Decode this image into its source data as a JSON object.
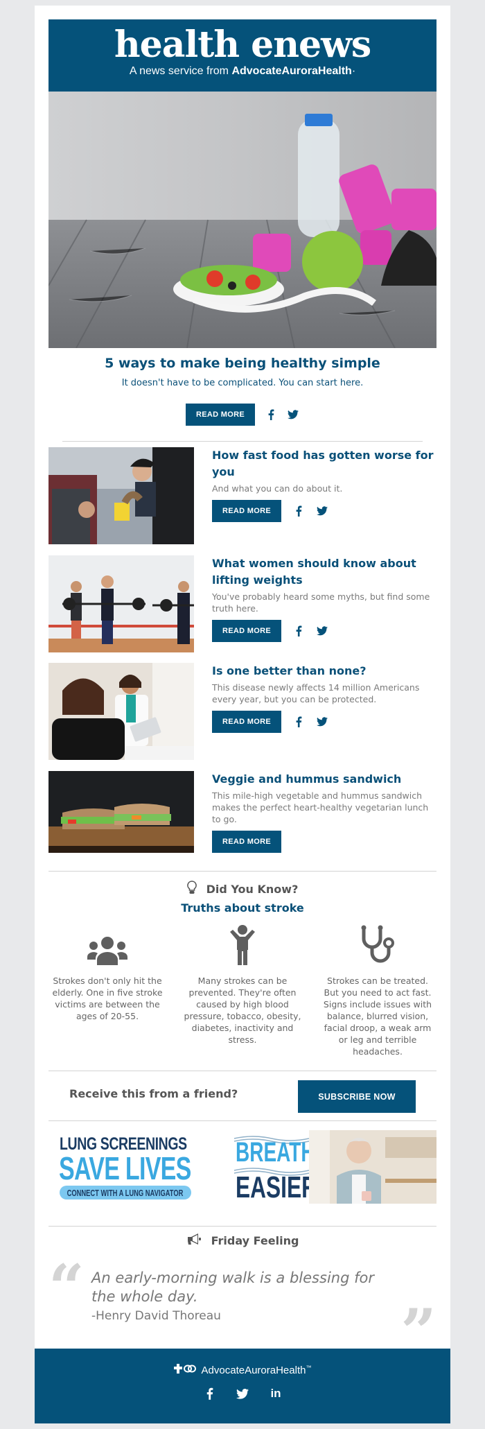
{
  "header": {
    "title": "health enews",
    "subtitle_prefix": "A news service from ",
    "subtitle_brand": "AdvocateAuroraHealth",
    "subtitle_mark": "·"
  },
  "hero": {
    "image_alt": "Water bottle, pink dumbbells, green apple, salad and measuring tape on wooden table",
    "title": "5 ways to make being healthy simple",
    "subtitle": "It doesn't have to be complicated. You can start here.",
    "read_more": "READ MORE",
    "share_icons": [
      "facebook-icon",
      "twitter-icon"
    ]
  },
  "stories": [
    {
      "title": "How fast food has gotten worse for you",
      "summary": "And what you can do about it.",
      "image_alt": "Drive-through worker handing food to a customer in a car",
      "read_more": "READ MORE",
      "share": true
    },
    {
      "title": "What women should know about lifting weights",
      "summary": "You've probably heard some myths, but find some truth here.",
      "image_alt": "Women lifting barbells in a gym class",
      "read_more": "READ MORE",
      "share": true
    },
    {
      "title": "Is one better than none?",
      "summary": "This disease newly affects 14 million Americans every year, but you can be protected.",
      "image_alt": "Doctor with tablet talking to a patient",
      "read_more": "READ MORE",
      "share": true
    },
    {
      "title": "Veggie and hummus sandwich",
      "summary": "This mile-high vegetable and hummus sandwich makes the perfect heart-healthy vegetarian lunch to go.",
      "image_alt": "Vegetable sandwich halves on a wooden board",
      "read_more": "READ MORE",
      "share": false
    }
  ],
  "did_you_know": {
    "heading": "Did You Know?",
    "subheading": "Truths about stroke",
    "facts": [
      {
        "icon": "group-icon",
        "text": "Strokes don't only hit the elderly. One in five stroke victims are between the ages of 20-55."
      },
      {
        "icon": "person-arms-up-icon",
        "text": "Many strokes can be prevented. They're often caused by high blood pressure, tobacco, obesity, diabetes, inactivity and stress."
      },
      {
        "icon": "stethoscope-icon",
        "text": "Strokes can be treated. But you need to act fast. Signs include issues with balance, blurred vision, facial droop, a weak arm or leg and terrible headaches."
      }
    ]
  },
  "subscribe": {
    "question": "Receive this from a friend?",
    "button": "SUBSCRIBE NOW"
  },
  "promos": {
    "lung": {
      "line1": "LUNG SCREENINGS",
      "line2": "SAVE LIVES",
      "cta": "CONNECT WITH A LUNG NAVIGATOR",
      "colors": {
        "dark": "#1b3c63",
        "light": "#3aa8e0",
        "pill": "#7cc8f0"
      }
    },
    "breathe": {
      "line1": "BREATHE",
      "line2": "EASIER",
      "image_alt": "Older woman holding a mug looking out a window"
    }
  },
  "friday": {
    "heading": "Friday Feeling",
    "quote": "An early-morning walk is a blessing for the whole day.",
    "author": "-Henry David Thoreau",
    "open_mark": "“",
    "close_mark": "”"
  },
  "footer": {
    "brand": "AdvocateAuroraHealth",
    "tm": "™",
    "socials": [
      "facebook-icon",
      "twitter-icon",
      "linkedin-icon"
    ],
    "linkedin_text": "in",
    "facebook_text": "f"
  },
  "colors": {
    "brand_blue": "#05527a",
    "headline_blue": "#0a5078",
    "body_gray": "#7a7a7a",
    "page_bg": "#e8e9eb"
  }
}
